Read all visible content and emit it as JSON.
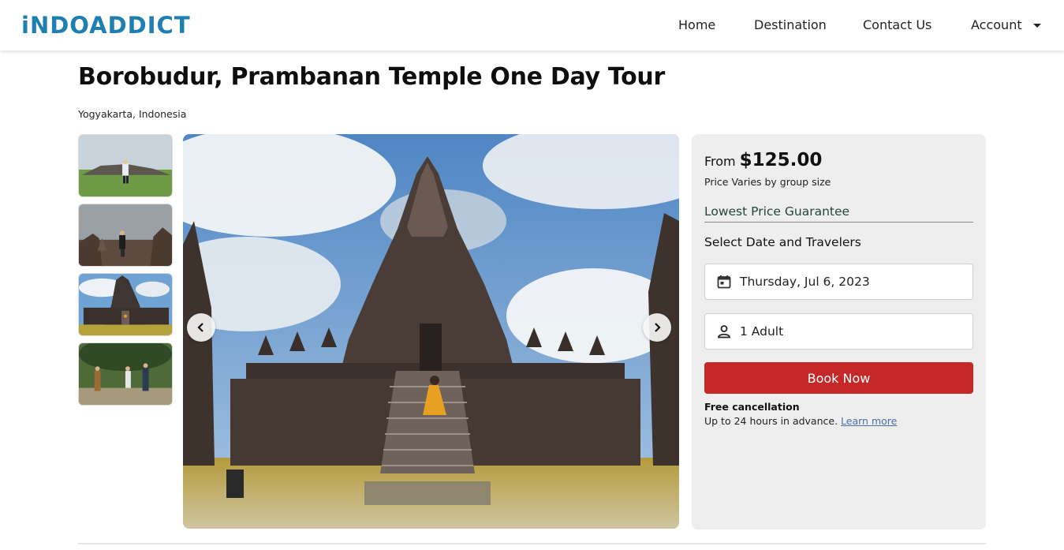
{
  "header": {
    "logo": "iNDOADDICT",
    "nav": {
      "home": "Home",
      "destination": "Destination",
      "contact": "Contact Us",
      "account": "Account"
    }
  },
  "tour": {
    "title": "Borobudur, Prambanan Temple One Day Tour",
    "location": "Yogyakarta, Indonesia"
  },
  "gallery": {
    "thumbnail_count": 4,
    "selected_thumbnail": 3
  },
  "booking": {
    "from_label": "From",
    "price": "$125.00",
    "price_note": "Price Varies by group size",
    "guarantee": "Lowest Price Guarantee",
    "select_label": "Select Date and Travelers",
    "date_value": "Thursday, Jul 6, 2023",
    "travelers_value": "1 Adult",
    "book_button": "Book Now",
    "cancel_title": "Free cancellation",
    "cancel_text": "Up to 24 hours in advance.",
    "learn_more": "Learn more"
  },
  "colors": {
    "brand": "#1f7fb0",
    "book_button": "#c62828",
    "guarantee_text": "#21473a",
    "panel_bg": "#eeeeee"
  },
  "icons": {
    "date": "calendar-icon",
    "travelers": "person-icon",
    "prev": "chevron-left-icon",
    "next": "chevron-right-icon",
    "account_menu": "caret-down-icon"
  }
}
